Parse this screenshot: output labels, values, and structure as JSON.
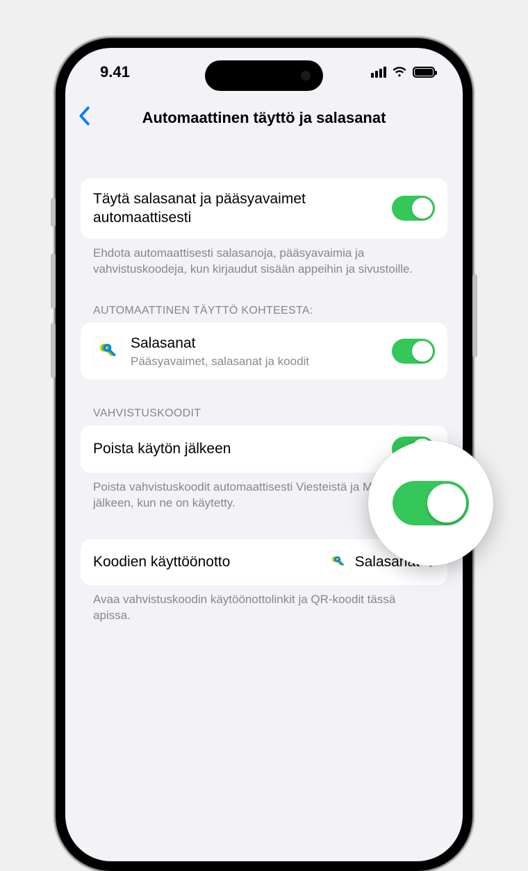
{
  "status": {
    "time": "9.41"
  },
  "nav": {
    "title": "Automaattinen täyttö ja salasanat"
  },
  "section1": {
    "title": "Täytä salasanat ja pääsyavaimet automaattisesti",
    "footer": "Ehdota automaattisesti salasanoja, pääsyavaimia ja vahvistuskoodeja, kun kirjaudut sisään appeihin ja sivustoille."
  },
  "section2": {
    "header": "AUTOMAATTINEN TÄYTTÖ KOHTEESTA:",
    "app_title": "Salasanat",
    "app_sub": "Pääsyavaimet, salasanat ja koodit"
  },
  "section3": {
    "header": "VAHVISTUSKOODIT",
    "row_title": "Poista käytön jälkeen",
    "footer": "Poista vahvistuskoodit automaattisesti Viesteistä ja Mailista sen jälkeen, kun ne on käytetty."
  },
  "section4": {
    "row_title": "Koodien käyttöönotto",
    "row_value": "Salasanat",
    "footer": "Avaa vahvistuskoodin käytöönottolinkit ja QR-koodit tässä apissa."
  }
}
